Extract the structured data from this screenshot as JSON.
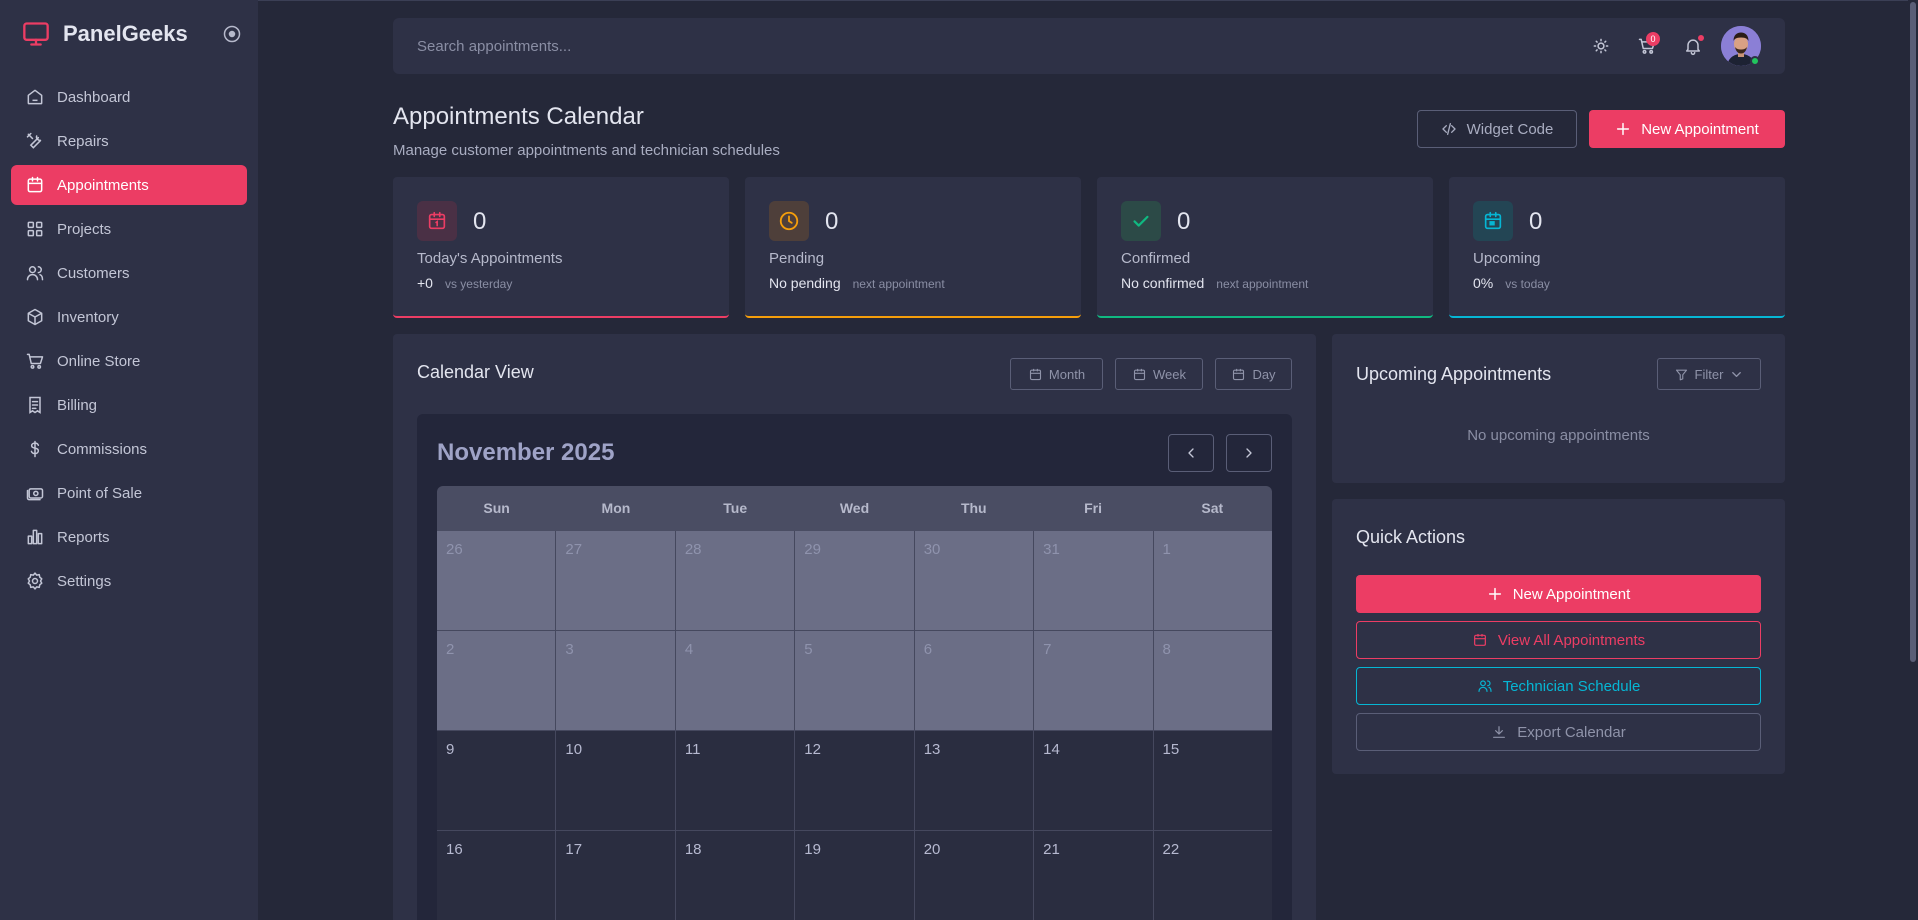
{
  "brand": {
    "name": "PanelGeeks"
  },
  "sidebar": {
    "items": [
      {
        "label": "Dashboard",
        "icon": "home-icon"
      },
      {
        "label": "Repairs",
        "icon": "tools-icon"
      },
      {
        "label": "Appointments",
        "icon": "calendar-icon",
        "active": true
      },
      {
        "label": "Projects",
        "icon": "grid-icon"
      },
      {
        "label": "Customers",
        "icon": "users-icon"
      },
      {
        "label": "Inventory",
        "icon": "box-icon"
      },
      {
        "label": "Online Store",
        "icon": "cart-icon"
      },
      {
        "label": "Billing",
        "icon": "receipt-icon"
      },
      {
        "label": "Commissions",
        "icon": "dollar-icon"
      },
      {
        "label": "Point of Sale",
        "icon": "cash-icon"
      },
      {
        "label": "Reports",
        "icon": "bar-chart-icon"
      },
      {
        "label": "Settings",
        "icon": "gear-icon"
      }
    ]
  },
  "topbar": {
    "search_placeholder": "Search appointments...",
    "cart_count": "0"
  },
  "header": {
    "title": "Appointments Calendar",
    "subtitle": "Manage customer appointments and technician schedules",
    "widget_label": "Widget Code",
    "new_label": "New Appointment"
  },
  "stats": [
    {
      "value": "0",
      "label": "Today's Appointments",
      "sub_main": "+0",
      "sub_note": "vs yesterday",
      "color": "#ec3d64"
    },
    {
      "value": "0",
      "label": "Pending",
      "sub_main": "No pending",
      "sub_note": "next appointment",
      "color": "#f59e0b"
    },
    {
      "value": "0",
      "label": "Confirmed",
      "sub_main": "No confirmed",
      "sub_note": "next appointment",
      "color": "#10b981"
    },
    {
      "value": "0",
      "label": "Upcoming",
      "sub_main": "0%",
      "sub_note": "vs today",
      "color": "#06b6d4"
    }
  ],
  "calendar": {
    "title": "Calendar View",
    "views": [
      "Month",
      "Week",
      "Day"
    ],
    "month_label": "November 2025",
    "weekdays": [
      "Sun",
      "Mon",
      "Tue",
      "Wed",
      "Thu",
      "Fri",
      "Sat"
    ],
    "weeks": [
      [
        "26",
        "27",
        "28",
        "29",
        "30",
        "31",
        "1"
      ],
      [
        "2",
        "3",
        "4",
        "5",
        "6",
        "7",
        "8"
      ],
      [
        "9",
        "10",
        "11",
        "12",
        "13",
        "14",
        "15"
      ],
      [
        "16",
        "17",
        "18",
        "19",
        "20",
        "21",
        "22"
      ]
    ],
    "dimmed_weeks": 2
  },
  "upcoming": {
    "title": "Upcoming Appointments",
    "filter_label": "Filter",
    "empty_text": "No upcoming appointments"
  },
  "quick_actions": {
    "title": "Quick Actions",
    "new_label": "New Appointment",
    "view_all_label": "View All Appointments",
    "tech_label": "Technician Schedule",
    "export_label": "Export Calendar"
  },
  "colors": {
    "accent": "#ec3d64",
    "pending": "#f59e0b",
    "confirmed": "#10b981",
    "upcoming": "#06b6d4"
  }
}
